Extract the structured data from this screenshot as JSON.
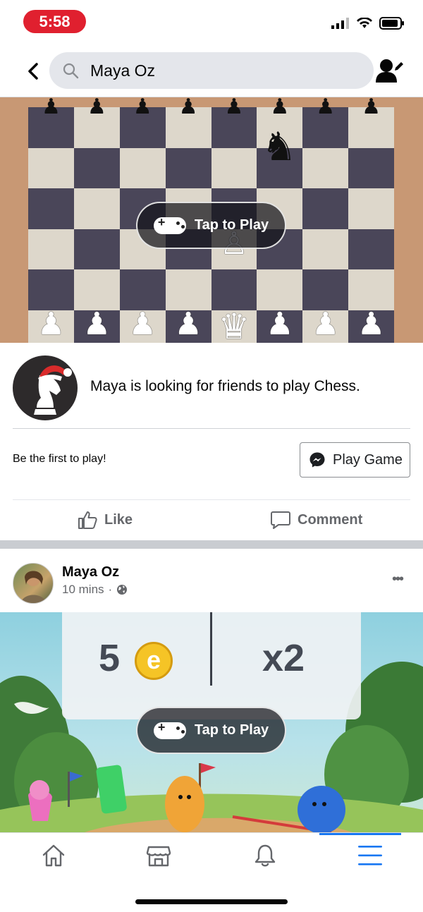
{
  "status_bar": {
    "time": "5:58",
    "signal_icon": "cellular-signal-icon",
    "wifi_icon": "wifi-icon",
    "battery_icon": "battery-icon"
  },
  "header": {
    "back_icon": "chevron-left-icon",
    "search_query": "Maya Oz",
    "search_icon": "magnifier-icon",
    "profile_icon": "edit-profile-icon"
  },
  "chess_post": {
    "tap_label": "Tap to Play",
    "message": "Maya is looking for friends to play Chess.",
    "cta_text": "Be the first to play!",
    "play_button": "Play Game",
    "like_label": "Like",
    "comment_label": "Comment"
  },
  "post2": {
    "author": "Maya Oz",
    "time": "10 mins",
    "separator": "·",
    "more": "•••",
    "tap_label": "Tap to Play",
    "score_value": "5",
    "coin_letter": "e",
    "multiplier": "x2"
  },
  "bottom_nav": {
    "items": [
      {
        "icon": "home-icon",
        "active": false
      },
      {
        "icon": "marketplace-icon",
        "active": false
      },
      {
        "icon": "bell-icon",
        "active": false
      },
      {
        "icon": "menu-icon",
        "active": true
      }
    ],
    "accent": "#1877f2"
  }
}
